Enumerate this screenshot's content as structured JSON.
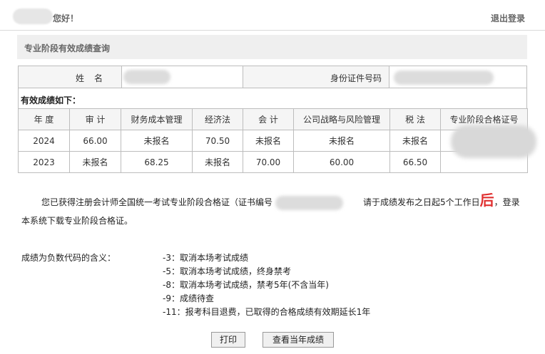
{
  "header": {
    "greeting": "您好！",
    "logout_label": "退出登录"
  },
  "section": {
    "title": "专业阶段有效成绩查询"
  },
  "info": {
    "name_label": "姓名",
    "id_label": "身份证件号码"
  },
  "scores": {
    "caption": "有效成绩如下：",
    "columns": [
      "年 度",
      "审 计",
      "财务成本管理",
      "经济法",
      "会 计",
      "公司战略与风险管理",
      "税 法",
      "专业阶段合格证号"
    ],
    "rows": [
      [
        "2024",
        "66.00",
        "未报名",
        "70.50",
        "未报名",
        "未报名",
        "未报名",
        ""
      ],
      [
        "2023",
        "未报名",
        "68.25",
        "未报名",
        "70.00",
        "60.00",
        "66.50",
        ""
      ]
    ]
  },
  "notice": {
    "part1": "您已获得注册会计师全国统一考试专业阶段合格证（证书编号",
    "part2": "请于成绩发布之日起5个工作日",
    "red": "后",
    "part3": "，登录本系统下载专业阶段合格证。"
  },
  "codes": {
    "label": "成绩为负数代码的含义：",
    "items": [
      "-3：取消本场考试成绩",
      "-5：取消本场考试成绩，终身禁考",
      "-8：取消本场考试成绩，禁考5年(不含当年)",
      "-9：成绩待查",
      "-11：报考科目退费，已取得的合格成绩有效期延长1年"
    ]
  },
  "buttons": {
    "print": "打印",
    "view_current": "查看当年成绩"
  }
}
